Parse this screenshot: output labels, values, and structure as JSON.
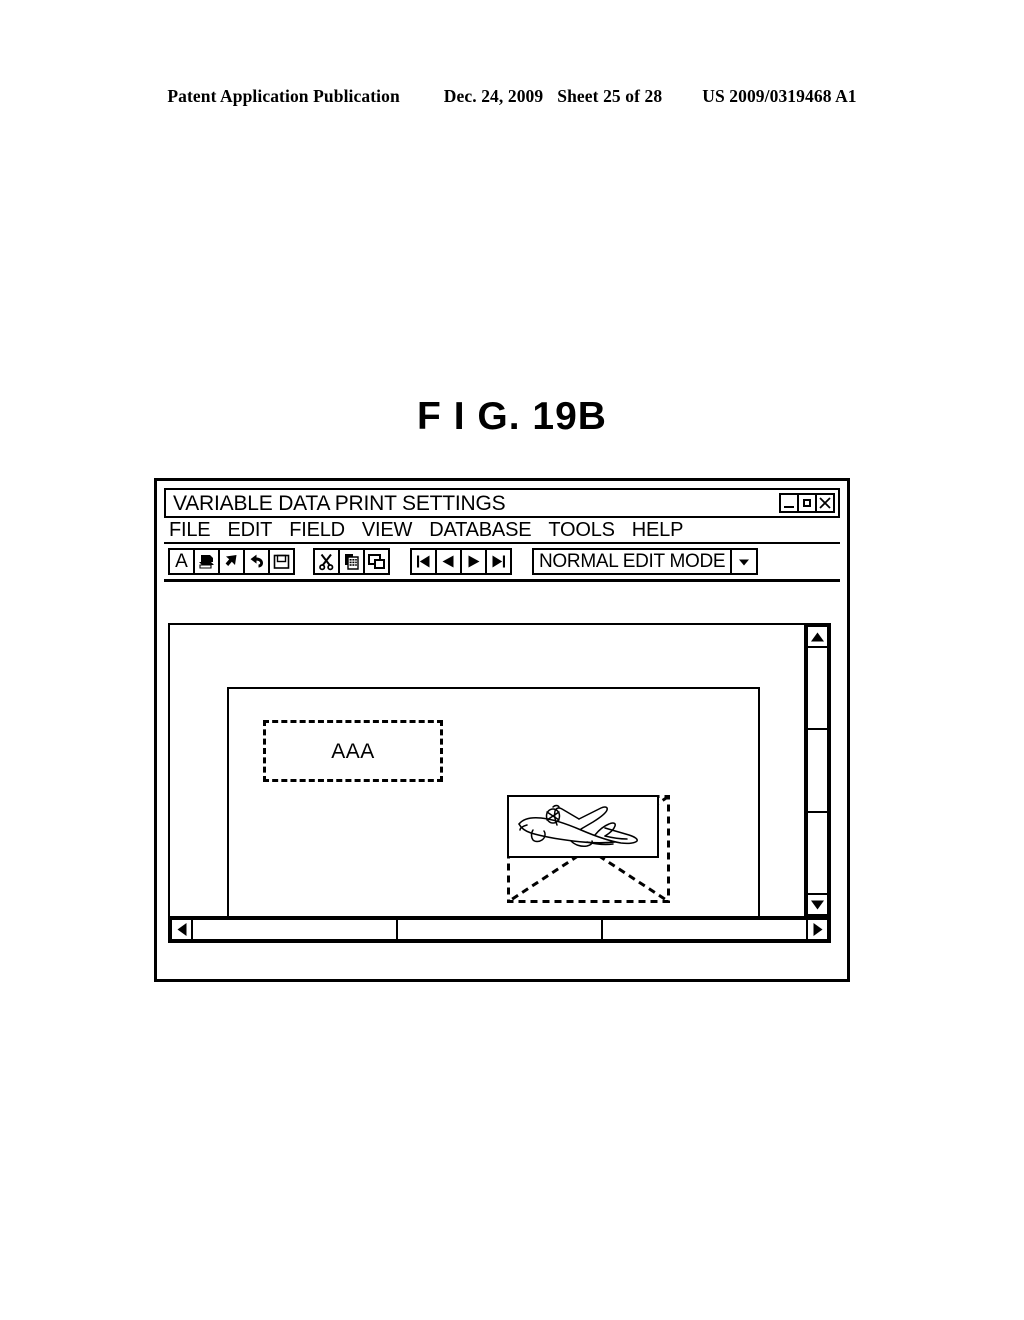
{
  "patent_header": {
    "publication": "Patent Application Publication",
    "date": "Dec. 24, 2009",
    "sheet": "Sheet 25 of 28",
    "number": "US 2009/0319468 A1"
  },
  "figure": {
    "title": "F I G. 19B"
  },
  "window": {
    "title": "VARIABLE DATA PRINT SETTINGS",
    "controls": {
      "minimize": "minimize-button",
      "maximize": "maximize-button",
      "close": "close-button"
    },
    "menu": [
      {
        "label": "FILE"
      },
      {
        "label": "EDIT"
      },
      {
        "label": "FIELD"
      },
      {
        "label": "VIEW"
      },
      {
        "label": "DATABASE"
      },
      {
        "label": "TOOLS"
      },
      {
        "label": "HELP"
      }
    ],
    "toolbar": {
      "group_edit": [
        {
          "icon": "text-tool-icon",
          "glyph": "A"
        },
        {
          "icon": "printer-icon"
        },
        {
          "icon": "pointer-arrow-icon"
        },
        {
          "icon": "undo-icon"
        },
        {
          "icon": "save-floppy-icon"
        }
      ],
      "group_clipboard": [
        {
          "icon": "cut-scissors-icon"
        },
        {
          "icon": "copy-icon"
        },
        {
          "icon": "paste-icon"
        }
      ],
      "group_navigation": [
        {
          "icon": "first-record-icon"
        },
        {
          "icon": "previous-record-icon"
        },
        {
          "icon": "next-record-icon"
        },
        {
          "icon": "last-record-icon"
        }
      ],
      "mode_select": {
        "value": "NORMAL EDIT MODE",
        "arrow_icon": "chevron-down-icon"
      }
    },
    "canvas": {
      "text_field": {
        "value": "AAA"
      },
      "image_field": {
        "content": "airplane-illustration"
      }
    },
    "scrollbars": {
      "vertical": {
        "up_icon": "triangle-up-icon",
        "down_icon": "triangle-down-icon",
        "segments": 3
      },
      "horizontal": {
        "left_icon": "triangle-left-icon",
        "right_icon": "triangle-right-icon",
        "segments": 3
      }
    }
  }
}
